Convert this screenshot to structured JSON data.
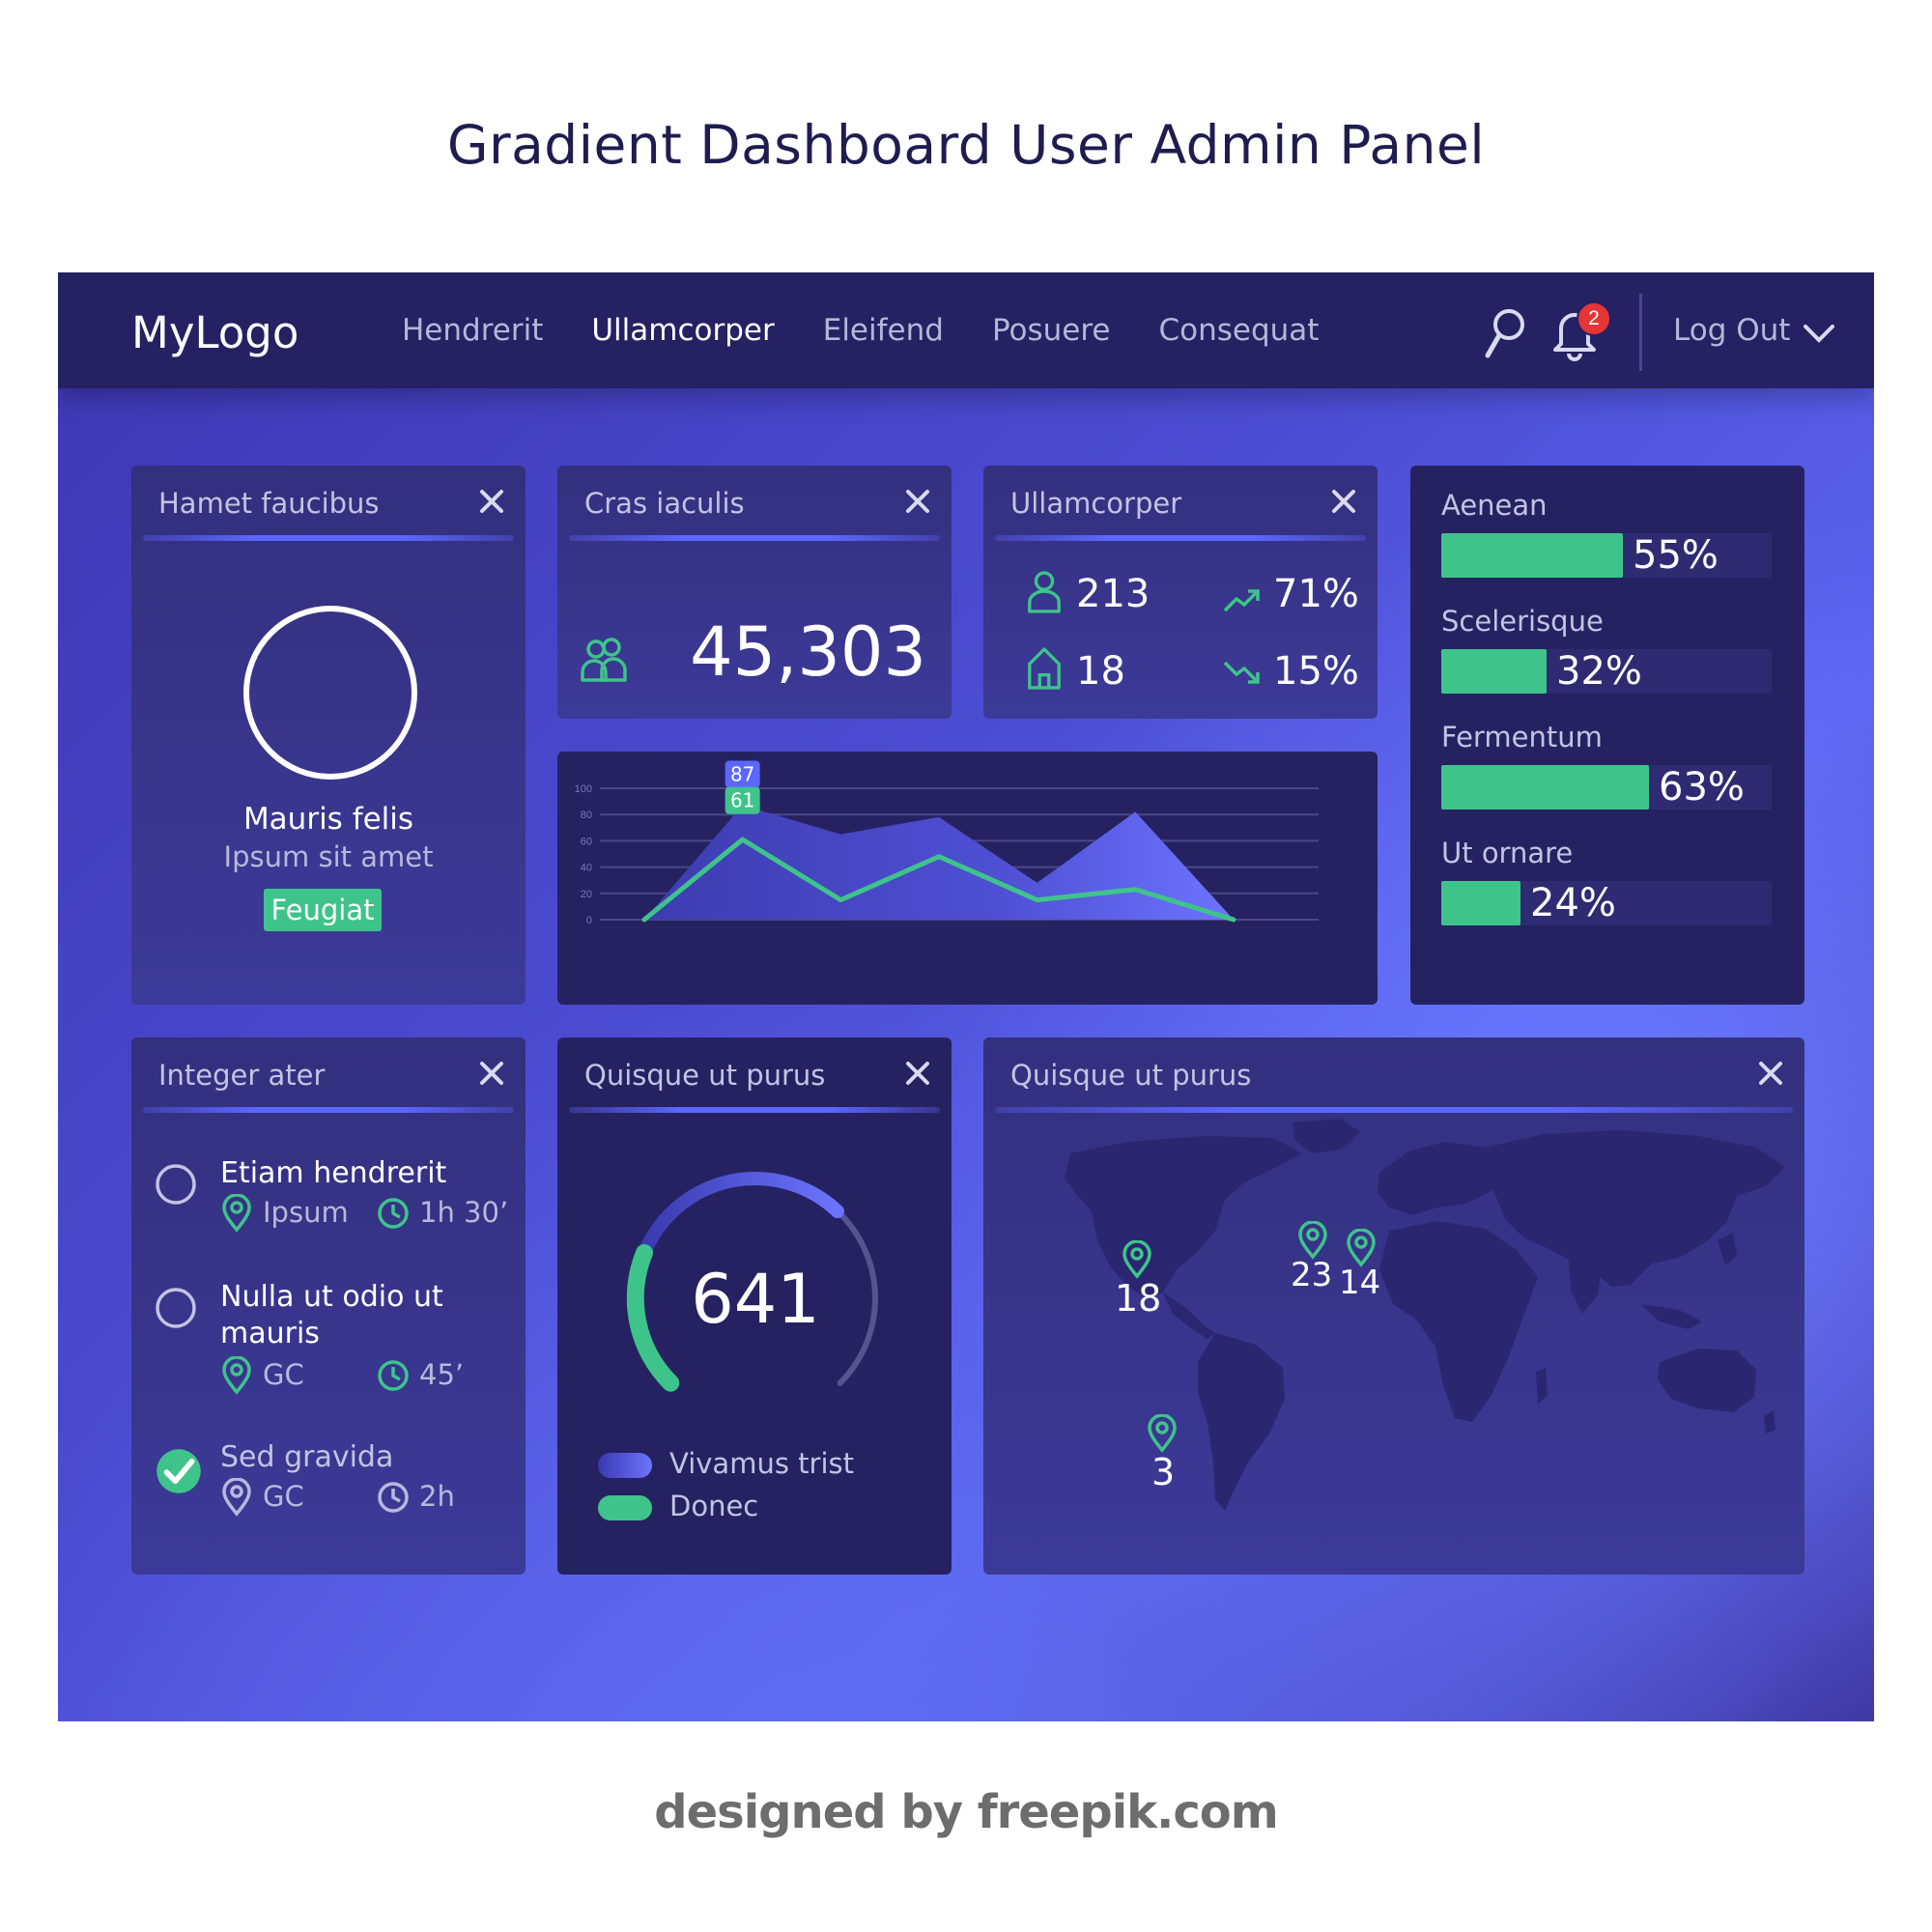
{
  "page_title": "Gradient Dashboard User Admin Panel",
  "header": {
    "logo": "MyLogo",
    "nav": [
      "Hendrerit",
      "Ullamcorper",
      "Eleifend",
      "Posuere",
      "Consequat"
    ],
    "active_nav": "Ullamcorper",
    "notification_count": "2",
    "logout_label": "Log Out"
  },
  "colors": {
    "accent": "#3ec48a",
    "card_dark": "#262261",
    "header": "#252163",
    "highlight": "#5b67ff"
  },
  "profile_card": {
    "title": "Hamet faucibus",
    "name": "Mauris felis",
    "subtitle": "Ipsum sit amet",
    "tag": "Feugiat"
  },
  "count_card": {
    "title": "Cras iaculis",
    "value": "45,303",
    "icon": "group-icon"
  },
  "stats_card": {
    "title": "Ullamcorper",
    "user_count": "213",
    "home_count": "18",
    "up_percent": "71%",
    "down_percent": "15%"
  },
  "chart_data": {
    "type": "area",
    "x": [
      1,
      2,
      3,
      4,
      5,
      6,
      7
    ],
    "ylim": [
      0,
      100
    ],
    "yticks": [
      "100",
      "80",
      "60",
      "40",
      "20",
      "0"
    ],
    "series": [
      {
        "values": [
          0,
          87,
          65,
          78,
          28,
          82,
          0
        ]
      },
      {
        "values": [
          0,
          61,
          15,
          48,
          15,
          23,
          0
        ]
      }
    ],
    "callouts": [
      "87",
      "61"
    ]
  },
  "progress_card": {
    "items": [
      {
        "label": "Aenean",
        "value": 55,
        "text": "55%"
      },
      {
        "label": "Scelerisque",
        "value": 32,
        "text": "32%"
      },
      {
        "label": "Fermentum",
        "value": 63,
        "text": "63%"
      },
      {
        "label": "Ut ornare",
        "value": 24,
        "text": "24%"
      }
    ]
  },
  "tasks_card": {
    "title": "Integer ater",
    "tasks": [
      {
        "title": "Etiam hendrerit",
        "place": "Ipsum",
        "time": "1h 30’",
        "done": false
      },
      {
        "title": "Nulla ut odio ut mauris",
        "place": "GC",
        "time": "45’",
        "done": false
      },
      {
        "title": "Sed gravida",
        "place": "GC",
        "time": "2h",
        "done": true
      }
    ]
  },
  "gauge_card": {
    "title": "Quisque ut purus",
    "value": "641",
    "legend": [
      "Vivamus trist",
      "Donec"
    ]
  },
  "map_card": {
    "title": "Quisque ut purus",
    "pins": [
      "18",
      "23",
      "14",
      "3"
    ]
  },
  "credit": "designed by freepik.com"
}
